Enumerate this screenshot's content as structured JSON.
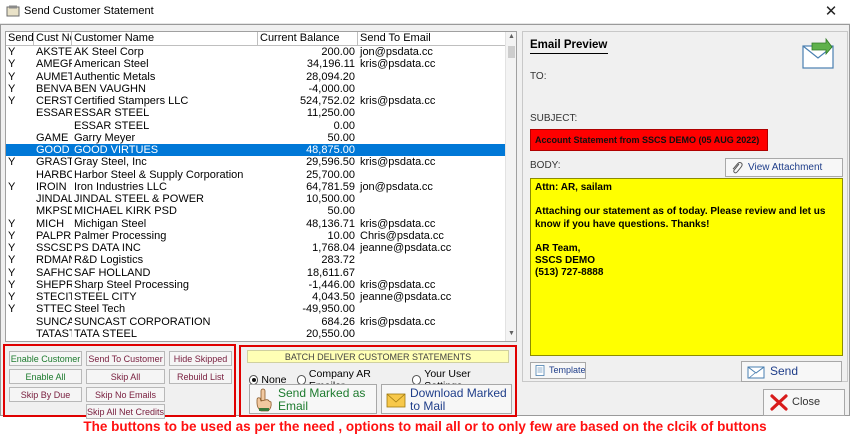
{
  "window": {
    "title": "Send Customer Statement",
    "close_glyph": "✕"
  },
  "grid": {
    "columns": [
      "Send",
      "Cust No",
      "Customer Name",
      "Current Balance",
      "Send To Email"
    ],
    "rows": [
      {
        "send": "Y",
        "no": "AKSTE",
        "name": "AK Steel Corp",
        "balance": "200.00",
        "email": "jon@psdata.cc"
      },
      {
        "send": "Y",
        "no": "AMEGR",
        "name": "American Steel",
        "balance": "34,196.11",
        "email": "kris@psdata.cc"
      },
      {
        "send": "Y",
        "no": "AUMET",
        "name": "Authentic Metals",
        "balance": "28,094.20",
        "email": ""
      },
      {
        "send": "Y",
        "no": "BENVAU",
        "name": "BEN VAUGHN",
        "balance": "-4,000.00",
        "email": ""
      },
      {
        "send": "Y",
        "no": "CERST",
        "name": "Certified Stampers LLC",
        "balance": "524,752.02",
        "email": "kris@psdata.cc"
      },
      {
        "send": "",
        "no": "ESSARS",
        "name": "ESSAR STEEL",
        "balance": "11,250.00",
        "email": ""
      },
      {
        "send": "",
        "no": "",
        "name": "ESSAR STEEL",
        "balance": "0.00",
        "email": ""
      },
      {
        "send": "",
        "no": "GAME",
        "name": "Garry Meyer",
        "balance": "50.00",
        "email": ""
      },
      {
        "send": "",
        "no": "GOOD",
        "name": "GOOD VIRTUES",
        "balance": "48,875.00",
        "email": "",
        "selected": true
      },
      {
        "send": "Y",
        "no": "GRAST",
        "name": "Gray Steel, Inc",
        "balance": "29,596.50",
        "email": "kris@psdata.cc"
      },
      {
        "send": "",
        "no": "HARBO",
        "name": "Harbor Steel & Supply Corporation",
        "balance": "25,700.00",
        "email": ""
      },
      {
        "send": "Y",
        "no": "IROIN",
        "name": "Iron Industries LLC",
        "balance": "64,781.59",
        "email": "jon@psdata.cc"
      },
      {
        "send": "",
        "no": "JINDAL",
        "name": "JINDAL STEEL & POWER",
        "balance": "10,500.00",
        "email": ""
      },
      {
        "send": "",
        "no": "MKPSD",
        "name": "MICHAEL KIRK PSD",
        "balance": "50.00",
        "email": ""
      },
      {
        "send": "Y",
        "no": "MICH",
        "name": "Michigan Steel",
        "balance": "48,136.71",
        "email": "kris@psdata.cc"
      },
      {
        "send": "Y",
        "no": "PALPR",
        "name": "Palmer Processing",
        "balance": "10.00",
        "email": "Chris@psdata.cc"
      },
      {
        "send": "Y",
        "no": "SSCSD",
        "name": "PS DATA INC",
        "balance": "1,768.04",
        "email": "jeanne@psdata.cc"
      },
      {
        "send": "Y",
        "no": "RDMAN",
        "name": "R&D Logistics",
        "balance": "283.72",
        "email": ""
      },
      {
        "send": "Y",
        "no": "SAFHOL",
        "name": "SAF HOLLAND",
        "balance": "18,611.67",
        "email": ""
      },
      {
        "send": "Y",
        "no": "SHEPR",
        "name": "Sharp Steel Processing",
        "balance": "-1,446.00",
        "email": "kris@psdata.cc"
      },
      {
        "send": "Y",
        "no": "STECIT",
        "name": "STEEL CITY",
        "balance": "4,043.50",
        "email": "jeanne@psdata.cc"
      },
      {
        "send": "Y",
        "no": "STTECH",
        "name": "Steel Tech",
        "balance": "-49,950.00",
        "email": ""
      },
      {
        "send": "",
        "no": "SUNCAS",
        "name": "SUNCAST CORPORATION",
        "balance": "684.26",
        "email": "kris@psdata.cc"
      },
      {
        "send": "",
        "no": "TATAST",
        "name": "TATA STEEL",
        "balance": "20,550.00",
        "email": ""
      }
    ]
  },
  "buttons": {
    "enable_customer": "Enable Customer",
    "send_to_customer": "Send To Customer",
    "hide_skipped": "Hide Skipped",
    "enable_all": "Enable All",
    "skip_all": "Skip All",
    "rebuild_list": "Rebuild List",
    "skip_by_due": "Skip By Due",
    "skip_no_emails": "Skip No Emails",
    "skip_all_net_credits": "Skip All Net Credits"
  },
  "batch": {
    "title": "BATCH DELIVER CUSTOMER STATEMENTS",
    "options": [
      "None",
      "Company AR Emailer",
      "Your User Settings"
    ],
    "selected_option": "None",
    "send_marked_label": "Send Marked as Email",
    "download_marked_label": "Download Marked to Mail"
  },
  "preview": {
    "title": "Email Preview",
    "to_label": "TO:",
    "to_value": "",
    "subject_label": "SUBJECT:",
    "subject_value": "Account Statement from SSCS DEMO (05 AUG 2022)",
    "body_label": "BODY:",
    "view_attachment": "View Attachment",
    "body_greeting": "Attn: AR, sailam",
    "body_message": "Attaching our statement as of today. Please review and let us know if you have questions. Thanks!",
    "body_sig1": "AR Team,",
    "body_sig2": "SSCS DEMO",
    "body_sig3": "(513) 727-8888",
    "template_label": "Template",
    "send_label": "Send"
  },
  "close_label": "Close",
  "caption": "The buttons to be used as per the need , options to mail all or to only few are based on the clcik of buttons",
  "colors": {
    "selection": "#0078d7",
    "subject_bg": "#ff0000",
    "body_bg": "#ffff00",
    "panel_border": "#e00000",
    "batch_title_bg": "#ffffb5",
    "caption": "#ff1010",
    "button_green": "#1d7b2e",
    "button_maroon": "#7a2040"
  }
}
